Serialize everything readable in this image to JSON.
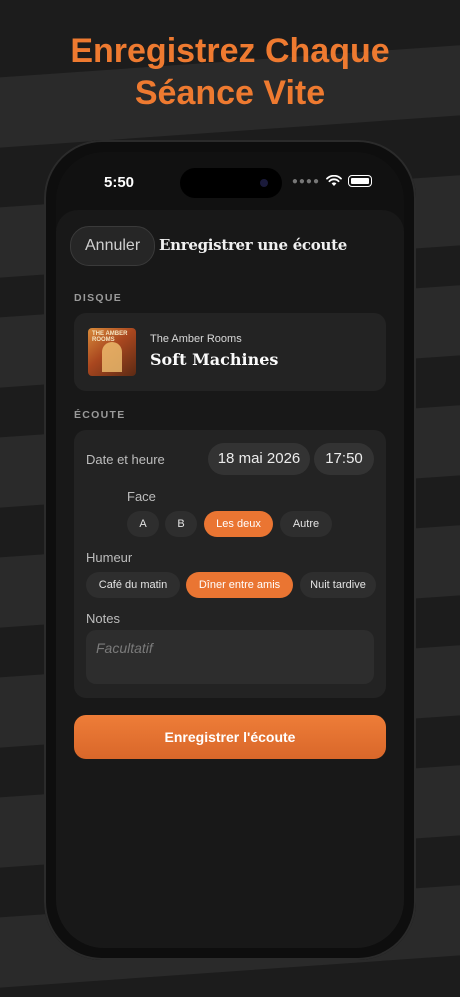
{
  "headline": {
    "line1": "Enregistrez Chaque",
    "line2": "Séance Vite"
  },
  "status_bar": {
    "time": "5:50",
    "icons": [
      "wifi-icon",
      "battery-icon"
    ]
  },
  "sheet": {
    "cancel_label": "Annuler",
    "title": "Enregistrer une écoute"
  },
  "disque": {
    "section_label": "DISQUE",
    "artist": "The Amber Rooms",
    "album": "Soft Machines",
    "art_text": "THE AMBER ROOMS"
  },
  "ecoute": {
    "section_label": "ÉCOUTE",
    "date_label": "Date et heure",
    "date_value": "18 mai 2026",
    "time_value": "17:50",
    "face_label": "Face",
    "face_options": [
      "A",
      "B",
      "Les deux",
      "Autre"
    ],
    "face_selected": "Les deux",
    "mood_label": "Humeur",
    "mood_options": [
      "Café du matin",
      "Dîner entre amis",
      "Nuit tardive"
    ],
    "mood_selected": "Dîner entre amis",
    "notes_label": "Notes",
    "notes_placeholder": "Facultatif"
  },
  "save_button": "Enregistrer l'écoute",
  "colors": {
    "accent": "#ea7532",
    "headline": "#ee7a30",
    "background": "#1c1c1c",
    "card": "#232323"
  }
}
